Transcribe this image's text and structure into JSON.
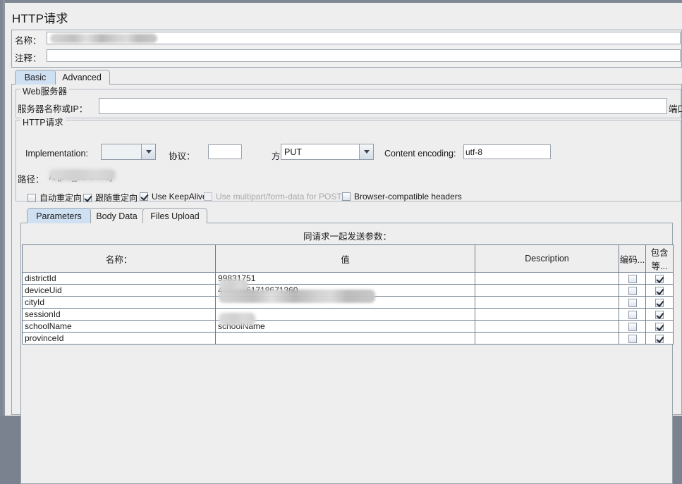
{
  "window": {
    "title": "HTTP请求"
  },
  "fields": {
    "name_label": "名称：",
    "name_value": "",
    "comment_label": "注释：",
    "comment_value": ""
  },
  "tabs": [
    {
      "label": "Basic",
      "selected": true
    },
    {
      "label": "Advanced",
      "selected": false
    }
  ],
  "web_server": {
    "group_title": "Web服务器",
    "server_label": "服务器名称或IP：",
    "server_value": "",
    "port_label": "端口"
  },
  "http_request": {
    "group_title": "HTTP请求",
    "implementation_label": "Implementation:",
    "implementation_value": "",
    "protocol_label": "协议：",
    "protocol_value": "",
    "method_label": "方法：",
    "method_value": "PUT",
    "content_encoding_label": "Content encoding:",
    "content_encoding_value": "utf-8",
    "path_label": "路径：",
    "path_value": "/${pm_schoolId}",
    "options": [
      {
        "label": "自动重定向",
        "checked": false,
        "enabled": true
      },
      {
        "label": "跟随重定向",
        "checked": true,
        "enabled": true
      },
      {
        "label": "Use KeepAlive",
        "checked": true,
        "enabled": true
      },
      {
        "label": "Use multipart/form-data for POST",
        "checked": false,
        "enabled": false
      },
      {
        "label": "Browser-compatible headers",
        "checked": false,
        "enabled": true
      }
    ]
  },
  "inner_tabs": [
    {
      "label": "Parameters",
      "selected": true
    },
    {
      "label": "Body Data",
      "selected": false
    },
    {
      "label": "Files Upload",
      "selected": false
    }
  ],
  "parameters": {
    "send_label": "同请求一起发送参数：",
    "columns": [
      "名称：",
      "值",
      "Description",
      "编码...",
      "包含等..."
    ],
    "rows": [
      {
        "name": "districtId",
        "value": "99831751",
        "description": "",
        "encode": false,
        "include": true,
        "redacted": false
      },
      {
        "name": "deviceUid",
        "value": "44420461718671360",
        "description": "",
        "encode": false,
        "include": true,
        "redacted": false
      },
      {
        "name": "cityId",
        "value": "",
        "description": "",
        "encode": false,
        "include": true,
        "redacted": true
      },
      {
        "name": "sessionId",
        "value": "",
        "description": "",
        "encode": false,
        "include": true,
        "redacted": true
      },
      {
        "name": "schoolName",
        "value": "schoolName",
        "description": "",
        "encode": false,
        "include": true,
        "redacted": false
      },
      {
        "name": "provinceId",
        "value": "",
        "description": "",
        "encode": false,
        "include": true,
        "redacted": true
      }
    ]
  },
  "colors": {
    "selected_tab": "#cfe0f2",
    "panel_bg": "#eeeeee",
    "frame": "#7f8792",
    "table_grid": "#6e7f91"
  }
}
